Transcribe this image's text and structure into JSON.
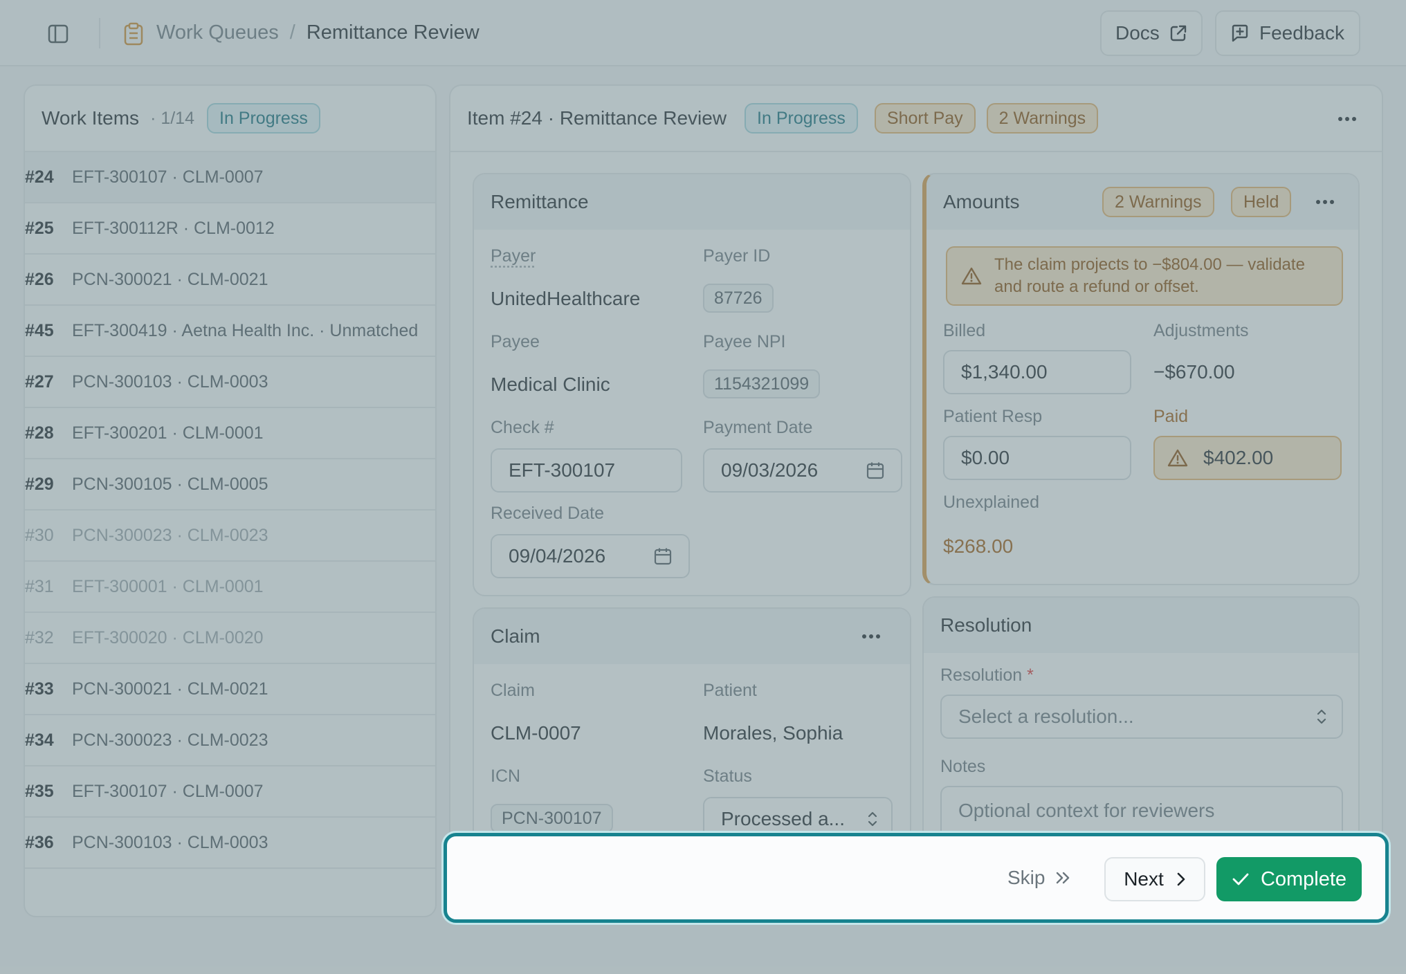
{
  "header": {
    "breadcrumb": {
      "parent": "Work Queues",
      "separator": "/",
      "current": "Remittance Review"
    },
    "docs_label": "Docs",
    "feedback_label": "Feedback",
    "icons": [
      "sidebar-toggle-icon",
      "clipboard-icon",
      "external-link-icon",
      "feedback-icon"
    ]
  },
  "work_items": {
    "title": "Work Items",
    "count": "· 1/14",
    "status": "In Progress",
    "rows": [
      {
        "num": "#24",
        "desc": "EFT-300107 · CLM-0007"
      },
      {
        "num": "#25",
        "desc": "EFT-300112R · CLM-0012"
      },
      {
        "num": "#26",
        "desc": "PCN-300021 · CLM-0021"
      },
      {
        "num": "#45",
        "desc": "EFT-300419 · Aetna Health Inc. · Unmatched"
      },
      {
        "num": "#27",
        "desc": "PCN-300103 · CLM-0003"
      },
      {
        "num": "#28",
        "desc": "EFT-300201 · CLM-0001"
      },
      {
        "num": "#29",
        "desc": "PCN-300105 · CLM-0005"
      },
      {
        "num": "#30",
        "desc": "PCN-300023 · CLM-0023"
      },
      {
        "num": "#31",
        "desc": "EFT-300001 · CLM-0001"
      },
      {
        "num": "#32",
        "desc": "EFT-300020 · CLM-0020"
      },
      {
        "num": "#33",
        "desc": "PCN-300021 · CLM-0021"
      },
      {
        "num": "#34",
        "desc": "PCN-300023 · CLM-0023"
      },
      {
        "num": "#35",
        "desc": "EFT-300107 · CLM-0007"
      },
      {
        "num": "#36",
        "desc": "PCN-300103 · CLM-0003"
      }
    ]
  },
  "item": {
    "title": "Item #24 · Remittance Review",
    "status": "In Progress",
    "tag_short_pay": "Short Pay",
    "tag_warnings": "2 Warnings"
  },
  "remittance": {
    "title": "Remittance",
    "payer_label": "Payer",
    "payer": "UnitedHealthcare",
    "payer_id_label": "Payer ID",
    "payer_id": "87726",
    "payee_label": "Payee",
    "payee": "Medical Clinic",
    "payee_npi_label": "Payee NPI",
    "payee_npi": "1154321099",
    "check_label": "Check #",
    "check": "EFT-300107",
    "payment_date_label": "Payment Date",
    "payment_date": "09/03/2026",
    "received_date_label": "Received Date",
    "received_date": "09/04/2026"
  },
  "claim": {
    "title": "Claim",
    "claim_label": "Claim",
    "claim": "CLM-0007",
    "patient_label": "Patient",
    "patient": "Morales, Sophia",
    "icn_label": "ICN",
    "icn": "PCN-300107",
    "status_label": "Status",
    "status": "Processed a..."
  },
  "amounts": {
    "title": "Amounts",
    "tag_warnings": "2 Warnings",
    "tag_held": "Held",
    "warning_line1": "The claim projects to −$804.00 — validate",
    "warning_line2": "and route a refund or offset.",
    "billed_label": "Billed",
    "billed": "$1,340.00",
    "adjustments_label": "Adjustments",
    "adjustments": "−$670.00",
    "patient_resp_label": "Patient Resp",
    "patient_resp": "$0.00",
    "paid_label": "Paid",
    "paid": "$402.00",
    "unexplained_label": "Unexplained",
    "unexplained": "$268.00"
  },
  "resolution": {
    "title": "Resolution",
    "resolution_label": "Resolution",
    "required_mark": "*",
    "resolution_placeholder": "Select a resolution...",
    "notes_label": "Notes",
    "notes_placeholder": "Optional context for reviewers"
  },
  "actions": {
    "skip_label": "Skip",
    "next_label": "Next",
    "complete_label": "Complete"
  },
  "colors": {
    "accent_teal": "#17838f",
    "complete_green": "#129a66",
    "warning_amber": "#fbe6c7",
    "status_blue": "#e1f3f6"
  }
}
